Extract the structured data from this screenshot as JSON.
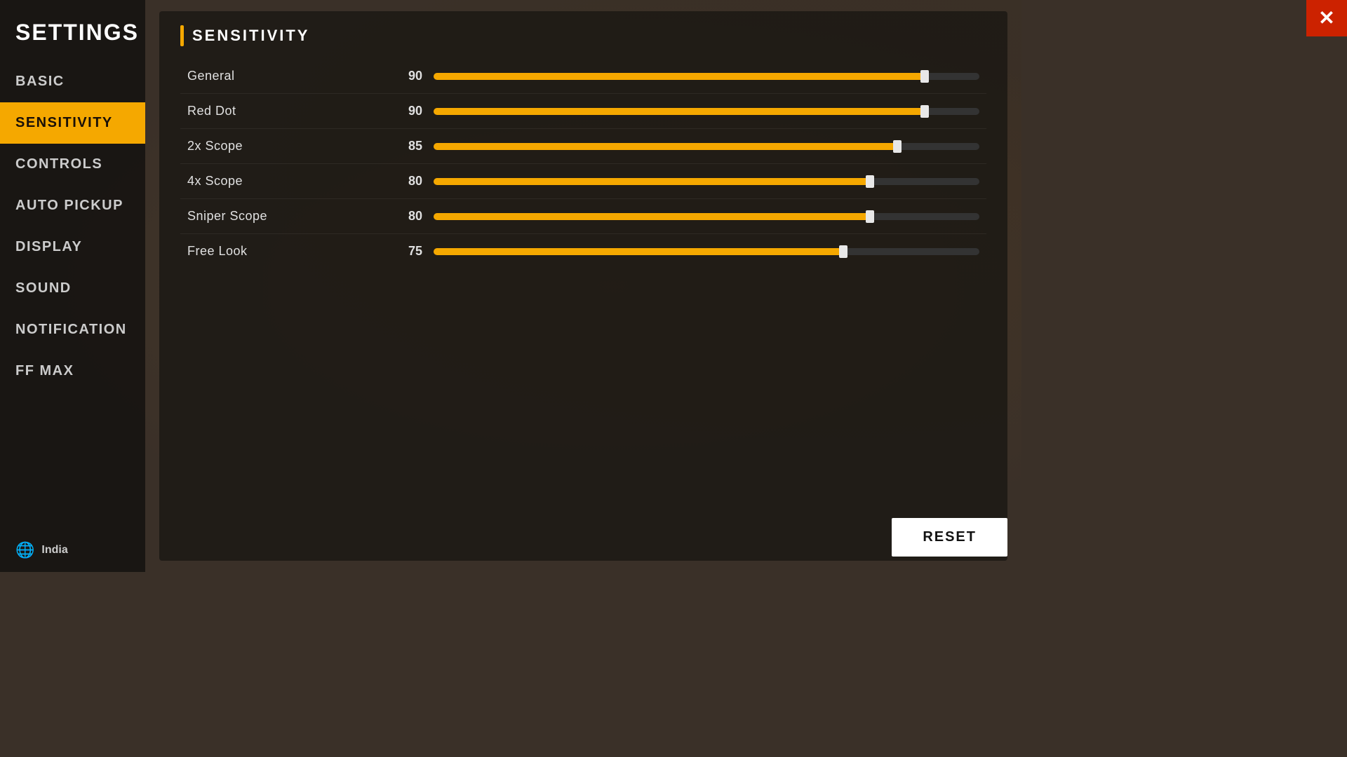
{
  "sidebar": {
    "title": "SETTINGS",
    "items": [
      {
        "id": "basic",
        "label": "BASIC",
        "active": false
      },
      {
        "id": "sensitivity",
        "label": "SENSITIVITY",
        "active": true
      },
      {
        "id": "controls",
        "label": "CONTROLS",
        "active": false
      },
      {
        "id": "auto-pickup",
        "label": "AUTO PICKUP",
        "active": false
      },
      {
        "id": "display",
        "label": "DISPLAY",
        "active": false
      },
      {
        "id": "sound",
        "label": "SOUND",
        "active": false
      },
      {
        "id": "notification",
        "label": "NOTIFICATION",
        "active": false
      },
      {
        "id": "ff-max",
        "label": "FF MAX",
        "active": false
      }
    ],
    "footer": {
      "region": "India",
      "globe_icon": "🌐"
    }
  },
  "panel": {
    "title": "SENSITIVITY",
    "sliders": [
      {
        "label": "General",
        "value": 90,
        "max": 100
      },
      {
        "label": "Red Dot",
        "value": 90,
        "max": 100
      },
      {
        "label": "2x Scope",
        "value": 85,
        "max": 100
      },
      {
        "label": "4x Scope",
        "value": 80,
        "max": 100
      },
      {
        "label": "Sniper Scope",
        "value": 80,
        "max": 100
      },
      {
        "label": "Free Look",
        "value": 75,
        "max": 100
      }
    ]
  },
  "buttons": {
    "reset_label": "RESET",
    "close_label": "✕"
  },
  "colors": {
    "accent": "#f5a800",
    "active_bg": "#f5a800",
    "close_bg": "#cc2200"
  }
}
